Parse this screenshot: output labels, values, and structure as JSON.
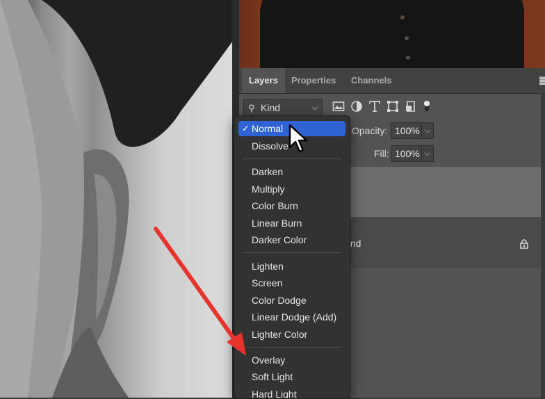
{
  "panel": {
    "tabs": [
      {
        "label": "Layers",
        "active": true
      },
      {
        "label": "Properties",
        "active": false
      },
      {
        "label": "Channels",
        "active": false
      }
    ],
    "filter": {
      "label": "Kind"
    },
    "opacity": {
      "label": "Opacity:",
      "value": "100%"
    },
    "fill": {
      "label": "Fill:",
      "value": "100%"
    },
    "layers": [
      {
        "name": ""
      },
      {
        "name": "und",
        "locked": true
      }
    ]
  },
  "blend_menu": {
    "selected": "Normal",
    "groups": [
      [
        "Normal",
        "Dissolve"
      ],
      [
        "Darken",
        "Multiply",
        "Color Burn",
        "Linear Burn",
        "Darker Color"
      ],
      [
        "Lighten",
        "Screen",
        "Color Dodge",
        "Linear Dodge (Add)",
        "Lighter Color"
      ],
      [
        "Overlay",
        "Soft Light",
        "Hard Light"
      ]
    ]
  },
  "colors": {
    "selection": "#2f63d4",
    "annotation_arrow": "#e8322c",
    "panel_bg": "#535353",
    "menu_bg": "#323232"
  }
}
